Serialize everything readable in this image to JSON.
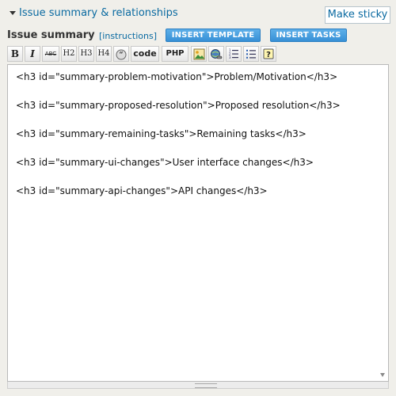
{
  "section": {
    "title": "Issue summary & relationships",
    "sticky_label": "Make sticky"
  },
  "field": {
    "label": "Issue summary",
    "instructions_link": "[instructions]",
    "insert_template_label": "INSERT TEMPLATE",
    "insert_tasks_label": "INSERT TASKS"
  },
  "toolbar": {
    "buttons": [
      {
        "label": "B",
        "icon": "bold-icon"
      },
      {
        "label": "I",
        "icon": "italic-icon"
      },
      {
        "label": "ABC",
        "icon": "strikethrough-icon"
      },
      {
        "label": "H2",
        "icon": "heading-2-icon"
      },
      {
        "label": "H3",
        "icon": "heading-3-icon"
      },
      {
        "label": "H4",
        "icon": "heading-4-icon"
      },
      {
        "label": "",
        "icon": "quote-icon"
      },
      {
        "label": "code",
        "icon": "code-icon"
      },
      {
        "label": "PHP",
        "icon": "php-icon"
      },
      {
        "label": "",
        "icon": "image-icon"
      },
      {
        "label": "",
        "icon": "link-icon"
      },
      {
        "label": "",
        "icon": "ordered-list-icon"
      },
      {
        "label": "",
        "icon": "unordered-list-icon"
      },
      {
        "label": "",
        "icon": "help-icon"
      }
    ]
  },
  "editor": {
    "lines": [
      "<h3 id=\"summary-problem-motivation\">Problem/Motivation</h3>",
      "<h3 id=\"summary-proposed-resolution\">Proposed resolution</h3>",
      "<h3 id=\"summary-remaining-tasks\">Remaining tasks</h3>",
      "<h3 id=\"summary-ui-changes\">User interface changes</h3>",
      "<h3 id=\"summary-api-changes\">API changes</h3>"
    ]
  },
  "colors": {
    "link": "#0a6aa1",
    "button_blue": "#3790d6",
    "background": "#f0efea"
  }
}
